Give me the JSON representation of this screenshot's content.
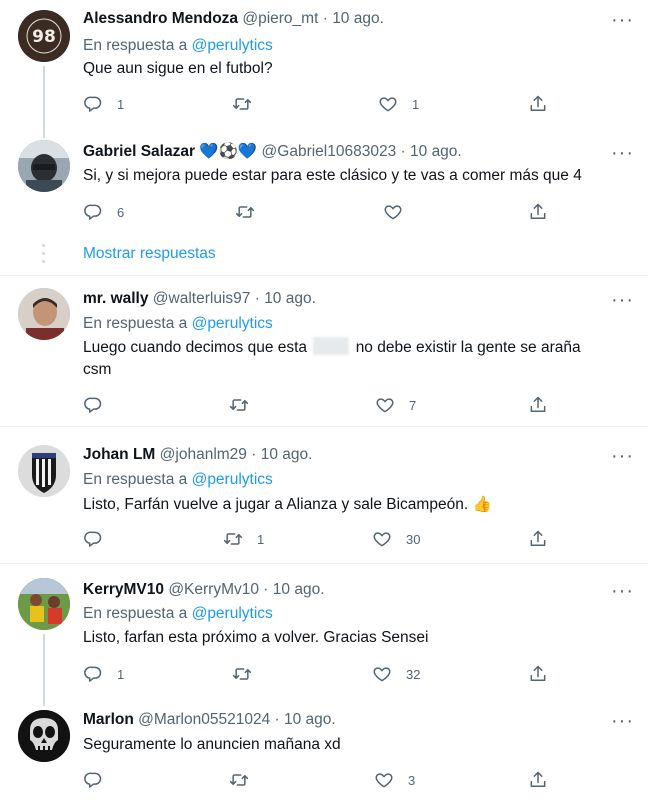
{
  "tweets": [
    {
      "name": "Alessandro Mendoza",
      "handle": "@piero_mt",
      "date": "10 ago.",
      "reply_prefix": "En respuesta a",
      "reply_mention": "@perulytics",
      "text": "Que aun sigue en el futbol?",
      "replies": "1",
      "retweets": "",
      "likes": "1",
      "avatar_text": "98"
    },
    {
      "name": "Gabriel Salazar",
      "name_emojis": "💙⚽💙",
      "handle": "@Gabriel10683023",
      "date": "10 ago.",
      "text": "Si, y si mejora puede estar para este clásico y te vas a comer más que 4",
      "replies": "6",
      "retweets": "",
      "likes": ""
    },
    {
      "name": "mr. wally",
      "handle": "@walterluis97",
      "date": "10 ago.",
      "reply_prefix": "En respuesta a",
      "reply_mention": "@perulytics",
      "text_before": "Luego cuando decimos que esta",
      "text_after": "no debe existir la gente se araña",
      "text_line2": "csm",
      "replies": "",
      "retweets": "",
      "likes": "7"
    },
    {
      "name": "Johan LM",
      "handle": "@johanlm29",
      "date": "10 ago.",
      "reply_prefix": "En respuesta a",
      "reply_mention": "@perulytics",
      "text": "Listo, Farfán vuelve a jugar a Alianza y sale Bicampeón.",
      "text_emoji": "👍",
      "replies": "",
      "retweets": "1",
      "likes": "30"
    },
    {
      "name": "KerryMV10",
      "handle": "@KerryMv10",
      "date": "10 ago.",
      "reply_prefix": "En respuesta a",
      "reply_mention": "@perulytics",
      "text": "Listo, farfan esta próximo a volver. Gracias Sensei",
      "replies": "1",
      "retweets": "",
      "likes": "32"
    },
    {
      "name": "Marlon",
      "handle": "@Marlon05521024",
      "date": "10 ago.",
      "text": "Seguramente lo anuncien mañana xd",
      "replies": "",
      "retweets": "",
      "likes": "3"
    }
  ],
  "show_replies_label": "Mostrar respuestas",
  "dot": "·",
  "more_icon": "···",
  "colors": {
    "accent": "#1d9bf0",
    "muted": "#536471",
    "divider": "#eff3f4"
  }
}
